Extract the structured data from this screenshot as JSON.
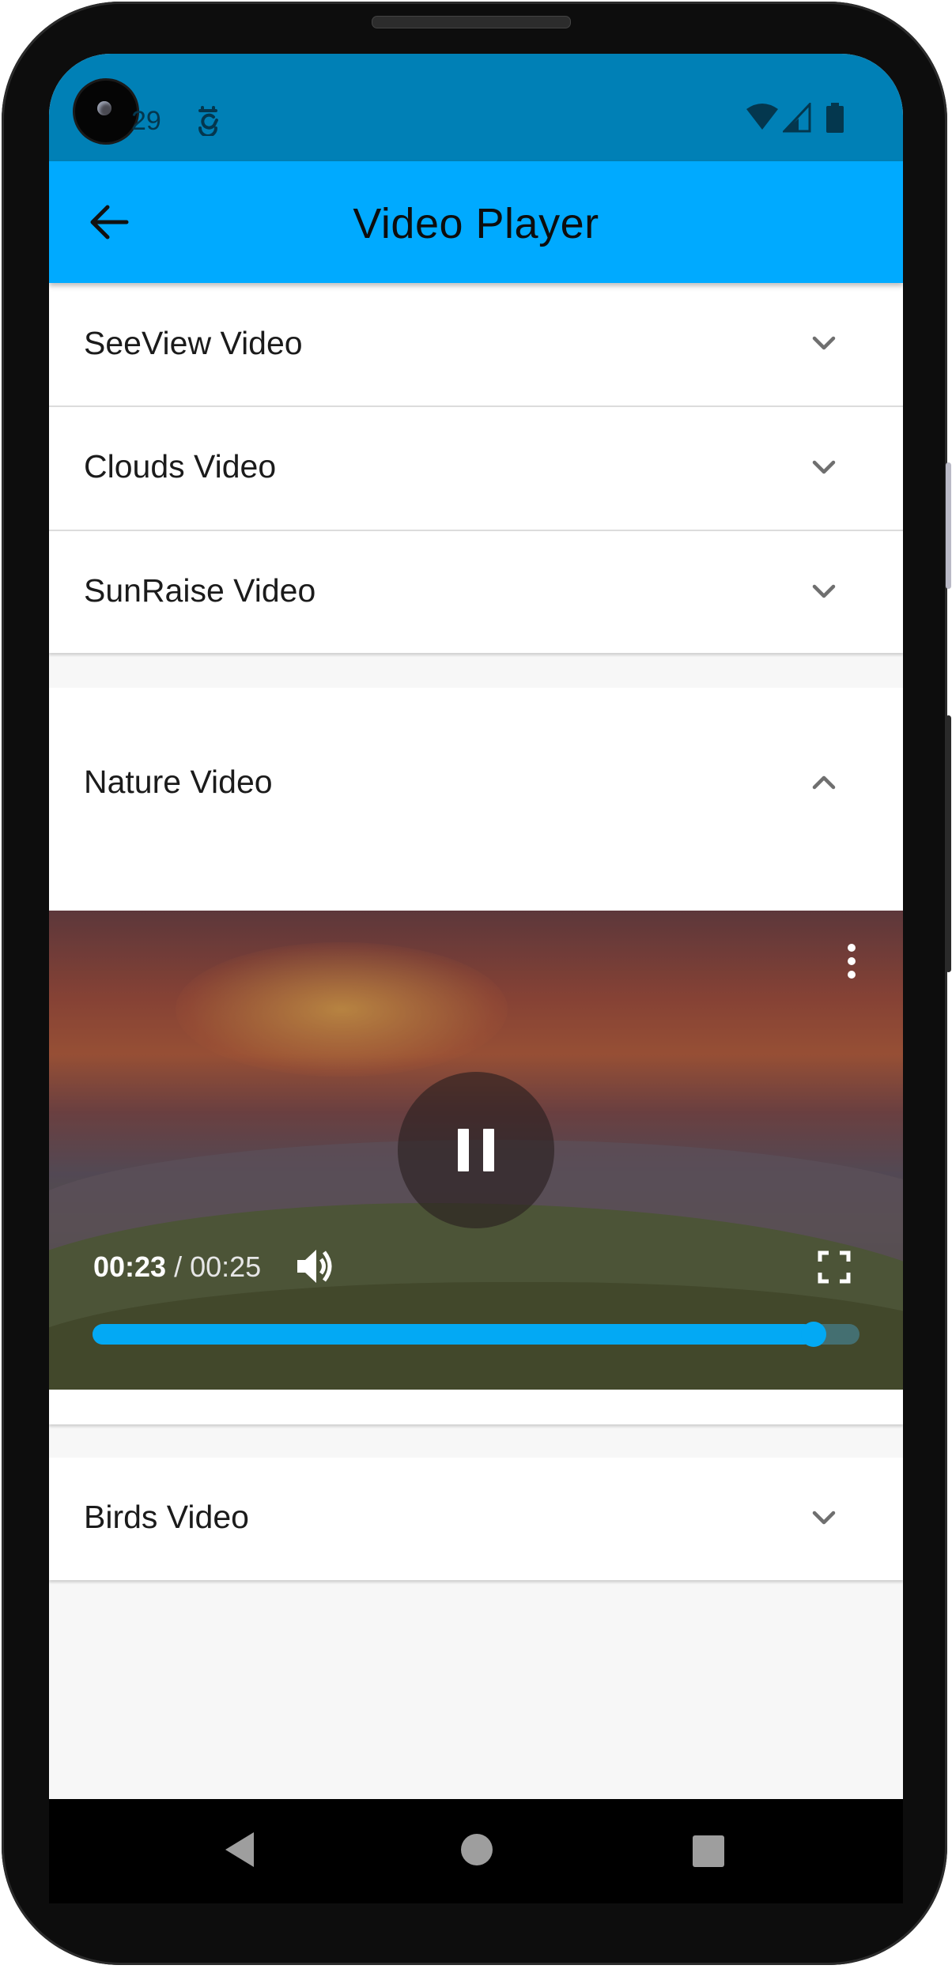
{
  "status_bar": {
    "time": "29"
  },
  "app_bar": {
    "title": "Video Player"
  },
  "videos": [
    {
      "label": "SeeView Video",
      "expanded": false
    },
    {
      "label": "Clouds Video",
      "expanded": false
    },
    {
      "label": "SunRaise Video",
      "expanded": false
    },
    {
      "label": "Nature Video",
      "expanded": true
    },
    {
      "label": "Birds Video",
      "expanded": false
    }
  ],
  "player": {
    "current_time": "00:23",
    "separator": " / ",
    "duration": "00:25",
    "progress_fraction": 0.94,
    "state": "playing"
  },
  "icons": {
    "back": "arrow-back-icon",
    "collapsed": "chevron-down-icon",
    "expanded": "chevron-up-icon",
    "pause": "pause-icon",
    "more": "more-vert-icon",
    "volume": "volume-up-icon",
    "fullscreen": "fullscreen-icon"
  },
  "colors": {
    "status_bar": "#0080b6",
    "app_bar": "#00aaff",
    "progress": "#03a9f4"
  }
}
